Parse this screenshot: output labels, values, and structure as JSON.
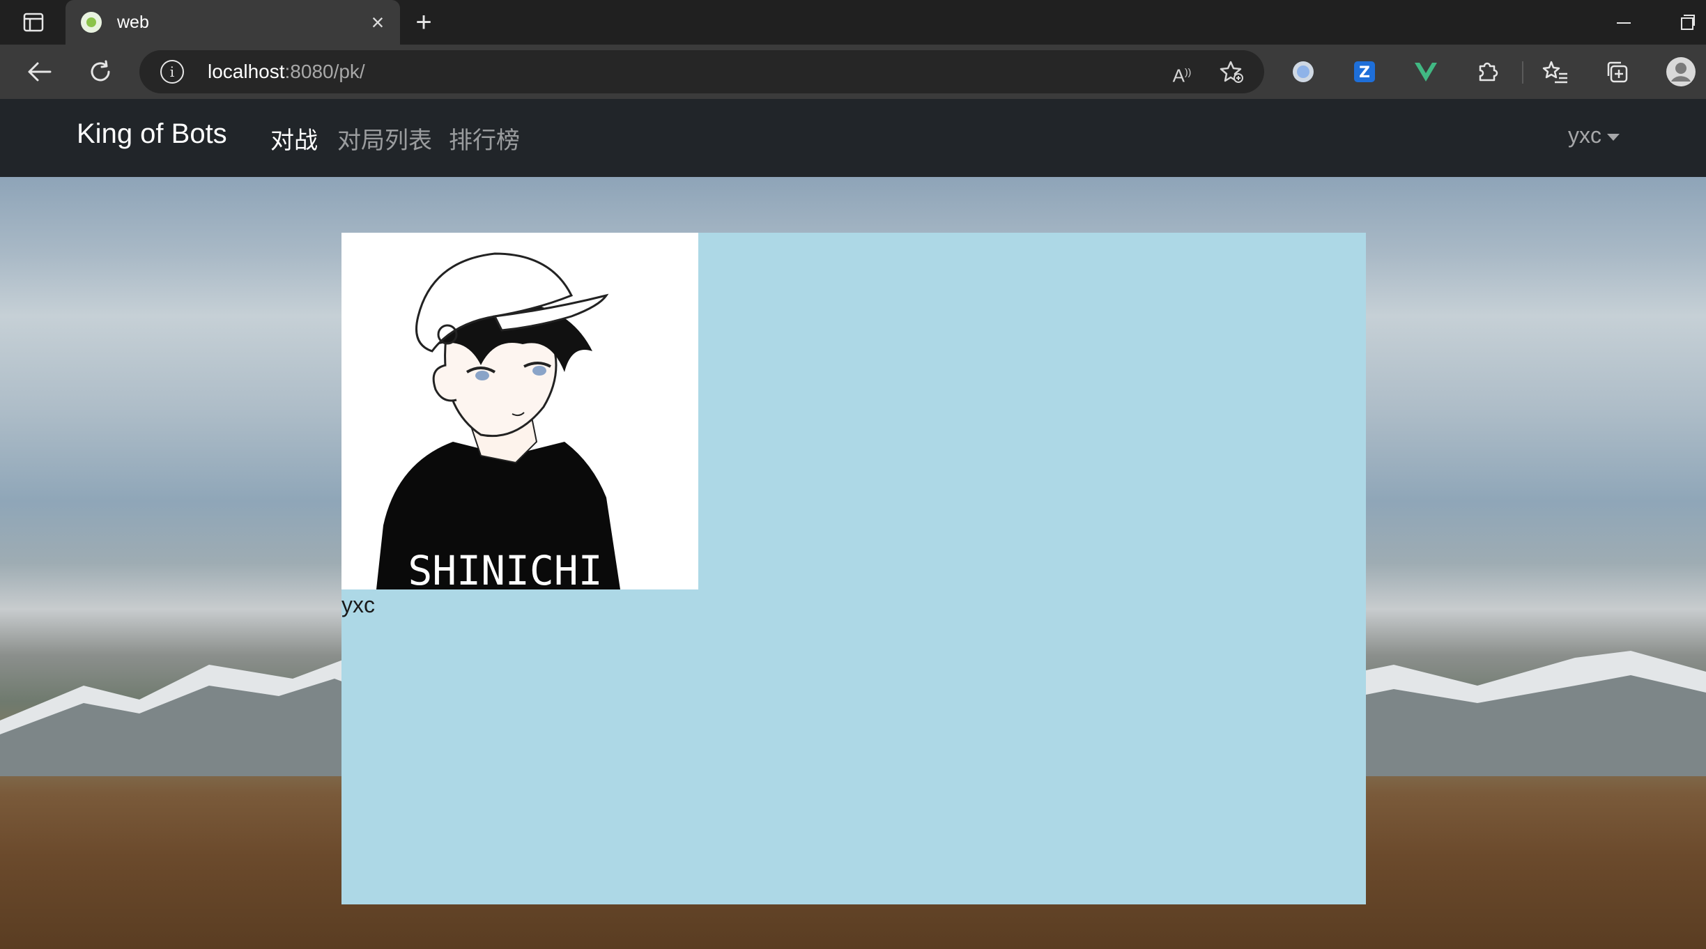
{
  "browser": {
    "tab_title": "web",
    "url_host": "localhost",
    "url_path": ":8080/pk/"
  },
  "navbar": {
    "brand": "King of Bots",
    "links": [
      {
        "label": "对战",
        "active": true
      },
      {
        "label": "对局列表",
        "active": false
      },
      {
        "label": "排行榜",
        "active": false
      }
    ],
    "user": "yxc"
  },
  "card": {
    "avatar_text": "SHINICHI",
    "username": "yxc"
  },
  "colors": {
    "navbar_bg": "#212529",
    "card_bg": "#add8e6"
  }
}
